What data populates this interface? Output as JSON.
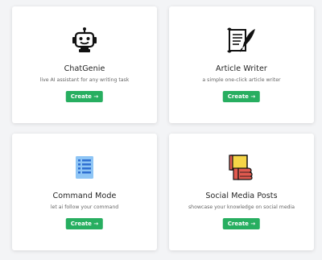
{
  "cards": [
    {
      "title": "ChatGenie",
      "subtitle": "live AI assistant for any writing task",
      "button": "Create →",
      "icon": "robot-icon"
    },
    {
      "title": "Article Writer",
      "subtitle": "a simple one-click article writer",
      "button": "Create →",
      "icon": "quill-paper-icon"
    },
    {
      "title": "Command Mode",
      "subtitle": "let ai follow your command",
      "button": "Create →",
      "icon": "list-document-icon"
    },
    {
      "title": "Social Media Posts",
      "subtitle": "showcase your knowledge on social media",
      "button": "Create →",
      "icon": "thumbs-up-sign-icon"
    }
  ],
  "colors": {
    "button": "#27ae60",
    "background": "#f3f4f6",
    "list_icon": "#8ec5f5",
    "sign_yellow": "#f5d547",
    "hand_red": "#e05a4f"
  }
}
